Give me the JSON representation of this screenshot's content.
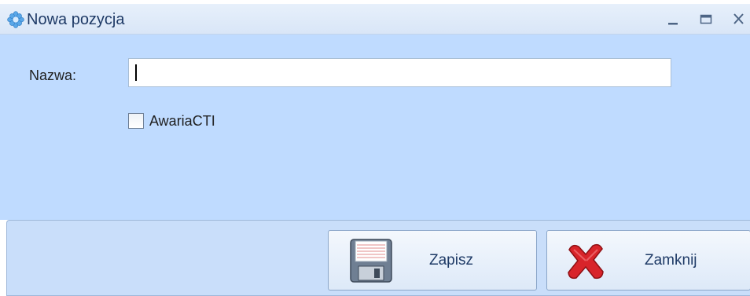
{
  "window": {
    "title": "Nowa pozycja",
    "icon": "app-flower-icon",
    "controls": {
      "minimize_icon": "minimize-icon",
      "maximize_icon": "maximize-icon",
      "close_icon": "close-icon"
    }
  },
  "form": {
    "name_label": "Nazwa:",
    "name_value": "",
    "checkbox_label": "AwariaCTI",
    "checkbox_checked": false
  },
  "buttons": {
    "save_label": "Zapisz",
    "save_icon": "floppy-disk-icon",
    "close_label": "Zamknij",
    "close_icon": "red-x-icon"
  },
  "colors": {
    "client_background": "#bfdbff",
    "footer_background": "#c9defa",
    "title_text": "#1e3a66"
  }
}
